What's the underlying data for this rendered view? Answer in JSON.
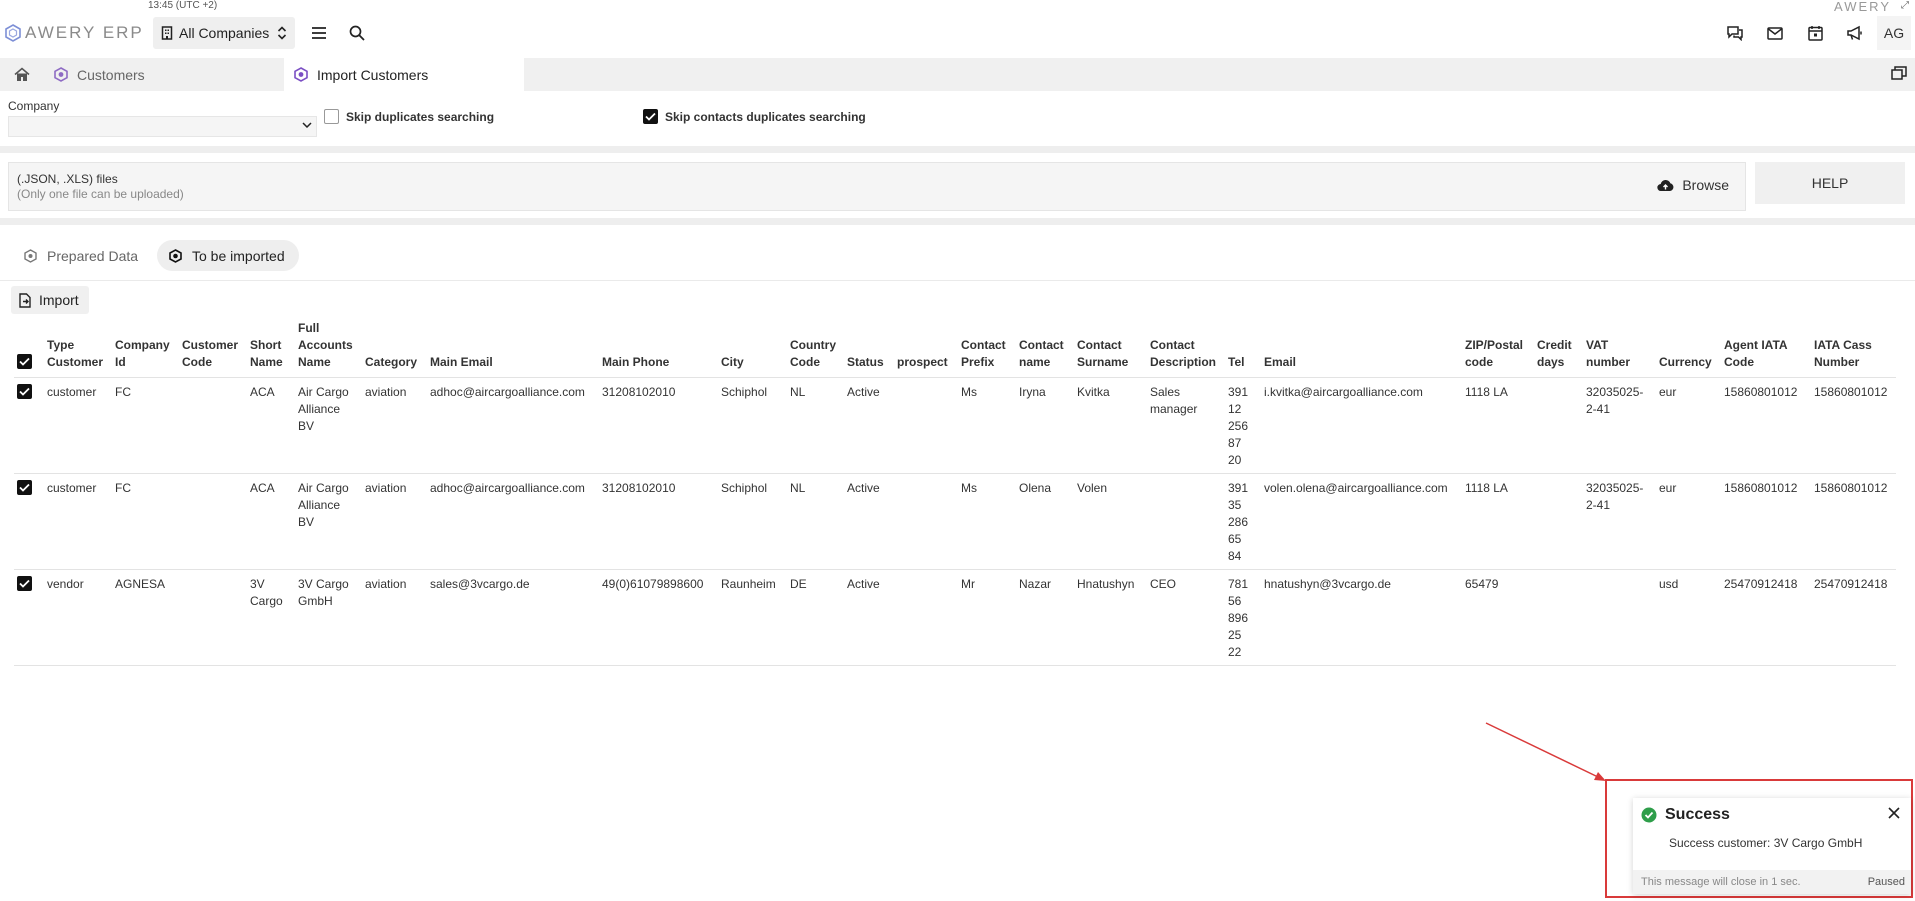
{
  "status": {
    "time": "13:45 (UTC +2)",
    "brand": "AWERY"
  },
  "topbar": {
    "logo": "AWERY ERP",
    "company_select": "All Companies",
    "user_initials": "AG"
  },
  "tabs": [
    {
      "label": "Customers"
    },
    {
      "label": "Import Customers"
    }
  ],
  "form": {
    "company_label": "Company",
    "company_value": "",
    "skip_duplicates_label": "Skip duplicates searching",
    "skip_duplicates_checked": false,
    "skip_contacts_label": "Skip contacts duplicates searching",
    "skip_contacts_checked": true
  },
  "upload": {
    "title": "(.JSON, .XLS) files",
    "hint": "(Only one file can be uploaded)",
    "browse_label": "Browse",
    "help_label": "HELP"
  },
  "view_toggle": {
    "prepared_label": "Prepared Data",
    "to_import_label": "To be imported",
    "selected": "To be imported"
  },
  "import_button": "Import",
  "table": {
    "columns": [
      "Type Customer",
      "Company Id",
      "Customer Code",
      "Short Name",
      "Full Accounts Name",
      "Category",
      "Main Email",
      "Main Phone",
      "City",
      "Country Code",
      "Status",
      "prospect",
      "Contact Prefix",
      "Contact name",
      "Contact Surname",
      "Contact Description",
      "Tel",
      "Email",
      "ZIP/Postal code",
      "Credit days",
      "VAT number",
      "Currency",
      "Agent IATA Code",
      "IATA Cass Number"
    ],
    "rows": [
      {
        "checked": true,
        "cells": [
          "customer",
          "FC",
          "",
          "ACA",
          "Air Cargo Alliance BV",
          "aviation",
          "adhoc@aircargoalliance.com",
          "31208102010",
          "Schiphol",
          "NL",
          "Active",
          "",
          "Ms",
          "Iryna",
          "Kvitka",
          "Sales manager",
          "391 12 256 87 20",
          "i.kvitka@aircargoalliance.com",
          "1118 LA",
          "",
          "32035025-2-41",
          "eur",
          "15860801012",
          "15860801012"
        ]
      },
      {
        "checked": true,
        "cells": [
          "customer",
          "FC",
          "",
          "ACA",
          "Air Cargo Alliance BV",
          "aviation",
          "adhoc@aircargoalliance.com",
          "31208102010",
          "Schiphol",
          "NL",
          "Active",
          "",
          "Ms",
          "Olena",
          "Volen",
          "",
          "391 35 286 65 84",
          "volen.olena@aircargoalliance.com",
          "1118 LA",
          "",
          "32035025-2-41",
          "eur",
          "15860801012",
          "15860801012"
        ]
      },
      {
        "checked": true,
        "cells": [
          "vendor",
          "AGNESA",
          "",
          "3V Cargo",
          "3V Cargo GmbH",
          "aviation",
          "sales@3vcargo.de",
          "49(0)61079898600",
          "Raunheim",
          "DE",
          "Active",
          "",
          "Mr",
          "Nazar",
          "Hnatushyn",
          "CEO",
          "781 56 896 25 22",
          "hnatushyn@3vcargo.de",
          "65479",
          "",
          "",
          "usd",
          "25470912418",
          "25470912418"
        ]
      }
    ]
  },
  "toast": {
    "title": "Success",
    "message": "Success customer: 3V Cargo GmbH",
    "footer": "This message will close in 1 sec.",
    "paused": "Paused",
    "accent": "#2e9e4a"
  },
  "colors": {
    "highlight": "#d93a3a",
    "tab_bg": "#f0f0f0"
  }
}
